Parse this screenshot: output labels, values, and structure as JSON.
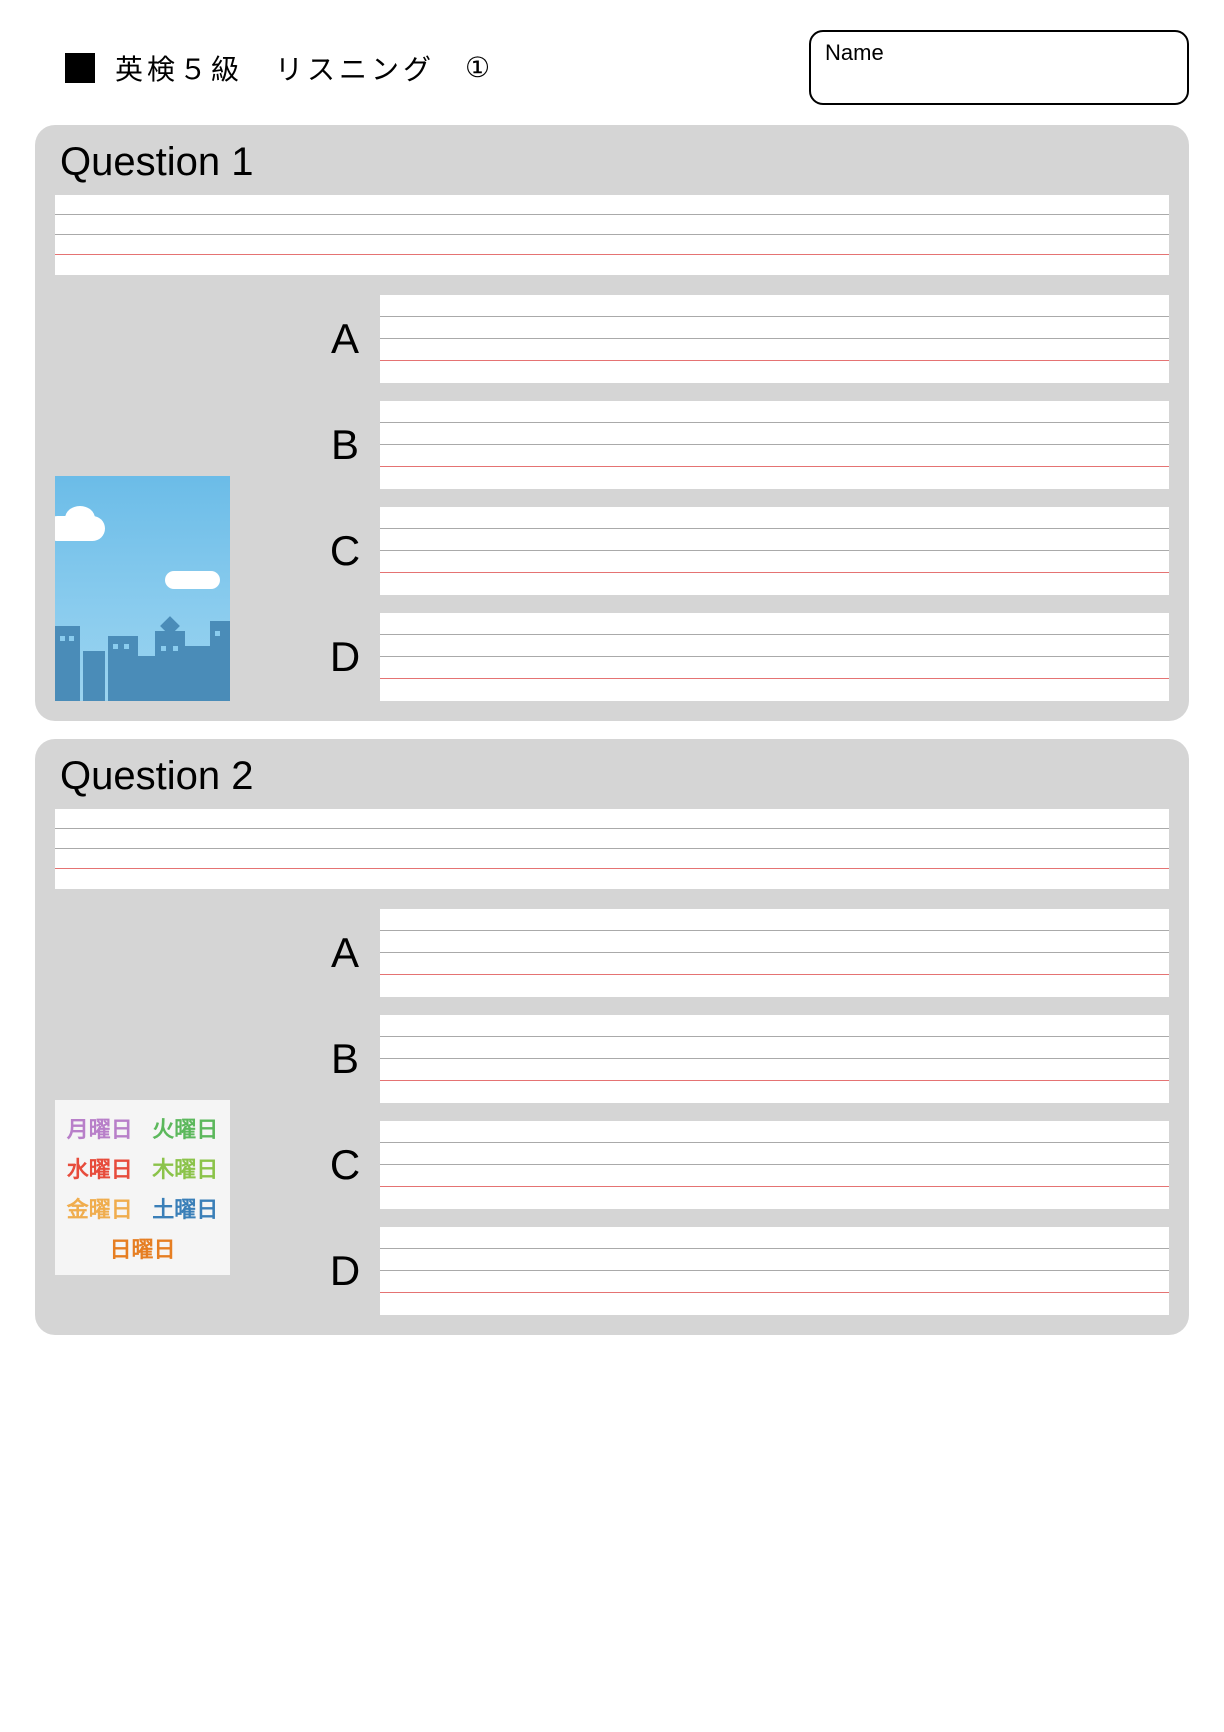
{
  "header": {
    "title": "英検５級　リスニング",
    "number": "①",
    "name_label": "Name"
  },
  "questions": [
    {
      "title": "Question 1",
      "options": [
        "A",
        "B",
        "C",
        "D"
      ],
      "illustration": "sky-city"
    },
    {
      "title": "Question 2",
      "options": [
        "A",
        "B",
        "C",
        "D"
      ],
      "illustration": "days-of-week"
    }
  ],
  "days": {
    "mon": "月曜日",
    "tue": "火曜日",
    "wed": "水曜日",
    "thu": "木曜日",
    "fri": "金曜日",
    "sat": "土曜日",
    "sun": "日曜日"
  }
}
